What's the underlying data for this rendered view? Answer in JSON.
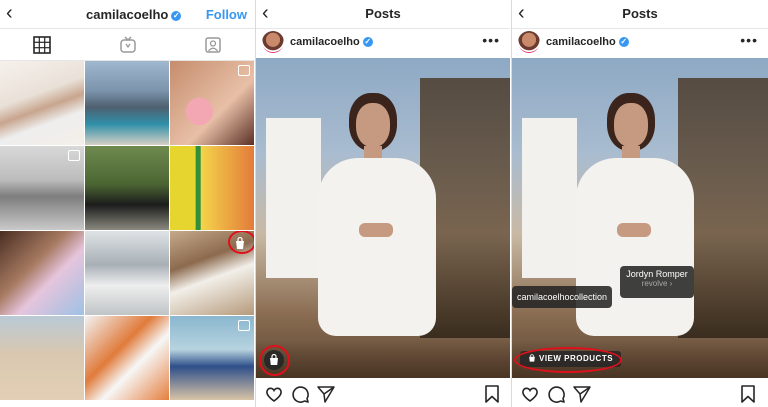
{
  "profile_panel": {
    "username": "camilacoelho",
    "follow_label": "Follow",
    "tabs": [
      "grid-icon",
      "igtv-icon",
      "tagged-icon"
    ],
    "grid_thumbnails": 12
  },
  "post_panel": {
    "title": "Posts",
    "username": "camilacoelho",
    "more_label": "•••"
  },
  "post_panel_tagged": {
    "title": "Posts",
    "username": "camilacoelho",
    "more_label": "•••",
    "product_tags": [
      {
        "name": "camilacoelhocollection",
        "sub": ""
      },
      {
        "name": "Jordyn Romper",
        "sub": "revolve ›"
      }
    ],
    "view_products_label": "VIEW PRODUCTS"
  },
  "colors": {
    "accent": "#3897f0",
    "highlight_ring": "#e0101a",
    "text": "#262626"
  }
}
